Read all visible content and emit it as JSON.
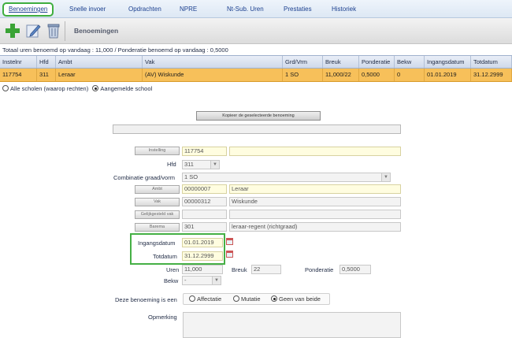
{
  "tabs": [
    {
      "label": "Benoemingen",
      "active": true
    },
    {
      "label": "Snelle invoer"
    },
    {
      "label": "Opdrachten"
    },
    {
      "label": "NPRE"
    },
    {
      "label": "Nt-Sub. Uren"
    },
    {
      "label": "Prestaties"
    },
    {
      "label": "Historiek"
    }
  ],
  "toolbar": {
    "title": "Benoemingen",
    "icons": [
      "add-icon",
      "edit-icon",
      "delete-icon"
    ]
  },
  "summary": "Totaal uren benoemd op vandaag : 11,000 / Ponderatie benoemd op vandaag : 0,5000",
  "grid": {
    "columns": [
      "Instelnr",
      "Hfd",
      "Ambt",
      "Vak",
      "Grd/Vrm",
      "Breuk",
      "Ponderatie",
      "Bekw",
      "Ingangsdatum",
      "Totdatum"
    ],
    "rows": [
      [
        "117754",
        "311",
        "Leraar",
        "(AV) Wiskunde",
        "1 SO",
        "11,000/22",
        "0,5000",
        "0",
        "01.01.2019",
        "31.12.2999"
      ]
    ]
  },
  "scope": {
    "option1": "Alle scholen (waarop rechten)",
    "option2": "Aangemelde school",
    "selected": "Aangemelde school"
  },
  "form": {
    "copy_button": "Kopieer de geselecteerde benoeming",
    "instelling_button": "Instelling",
    "instelling_value": "117754",
    "instelling_name": "",
    "hfd_label": "Hfd",
    "hfd_value": "311",
    "combinatie_label": "Combinatie graad/vorm",
    "combinatie_value": "1 SO",
    "ambt_button": "Ambt",
    "ambt_code": "00000007",
    "ambt_name": "Leraar",
    "vak_button": "Vak",
    "vak_code": "00000312",
    "vak_name": "Wiskunde",
    "gelijkgesteld_button": "Gelijkgesteld vak",
    "gelijkgesteld_code": "",
    "gelijkgesteld_name": "",
    "barema_button": "Barema",
    "barema_code": "301",
    "barema_name": "leraar-regent (richtgraad)",
    "ingangsdatum_label": "Ingangsdatum",
    "ingangsdatum_value": "01.01.2019",
    "totdatum_label": "Totdatum",
    "totdatum_value": "31.12.2999",
    "uren_label": "Uren",
    "uren_value": "11,000",
    "breuk_label": "Breuk",
    "breuk_value": "22",
    "ponderatie_label": "Ponderatie",
    "ponderatie_value": "0,5000",
    "bekw_label": "Bekw",
    "bekw_value": "-",
    "benoeming_label": "Deze benoeming is een",
    "radio_affectatie": "Affectatie",
    "radio_mutatie": "Mutatie",
    "radio_geen": "Geen van beide",
    "opmerking_label": "Opmerking"
  },
  "colors": {
    "highlight": "#45b045",
    "selected_row": "#f7c05a"
  }
}
